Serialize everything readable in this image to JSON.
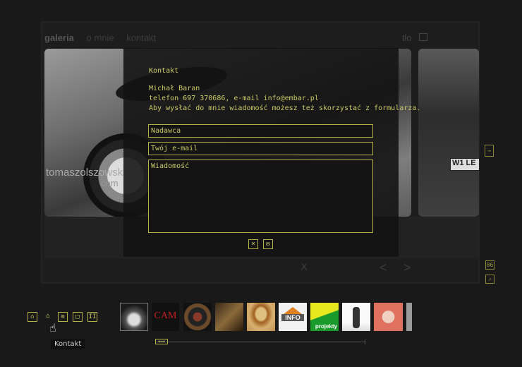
{
  "nav": {
    "items": [
      "galeria",
      "o mnie",
      "kontakt"
    ],
    "active": "galeria",
    "bg_label": "tło"
  },
  "watermark": {
    "line1": "tomaszolszowski",
    "line2": "com"
  },
  "plate_text": "W1 LE",
  "contact": {
    "title": "Kontakt",
    "name": "Michał Baran",
    "phone_line": "telefon 697 370686, e-mail info@embar.pl",
    "info_line": "Aby wysłać do mnie wiadomość możesz też skorzystać z formularza.",
    "sender_placeholder": "Nadawca",
    "email_placeholder": "Twój e-mail",
    "message_placeholder": "Wiadomość",
    "cancel_icon": "×",
    "send_icon": "✉"
  },
  "gallery_nav": {
    "close": "X",
    "prev": "<",
    "next": ">"
  },
  "side_buttons": {
    "next": "→",
    "size": "86",
    "open": "⇗"
  },
  "toolbar": {
    "home": "⌂",
    "up": "⌂",
    "list": "≡",
    "fullscreen": "□",
    "pause": "II"
  },
  "tooltip": "Kontakt",
  "thumbnails": {
    "cam_text": "CAM",
    "info_text": "INFO",
    "projekty_text": "projekty"
  },
  "scrollbar": {
    "handle_glyph": "⟺"
  },
  "colors": {
    "accent": "#c9c96a",
    "border": "#b3b34a",
    "background": "#191919"
  }
}
